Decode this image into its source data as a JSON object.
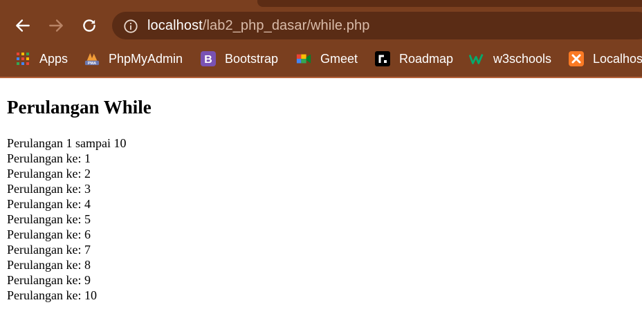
{
  "browser": {
    "url_host": "localhost",
    "url_path": "/lab2_php_dasar/while.php",
    "bookmarks": [
      {
        "label": "Apps",
        "icon": "apps-grid-icon"
      },
      {
        "label": "PhpMyAdmin",
        "icon": "phpmyadmin-icon"
      },
      {
        "label": "Bootstrap",
        "icon": "bootstrap-icon"
      },
      {
        "label": "Gmeet",
        "icon": "gmeet-icon"
      },
      {
        "label": "Roadmap",
        "icon": "roadmap-icon"
      },
      {
        "label": "w3schools",
        "icon": "w3schools-icon"
      },
      {
        "label": "Localhost",
        "icon": "xampp-icon"
      }
    ]
  },
  "page": {
    "heading": "Perulangan While",
    "lines": [
      "Perulangan 1 sampai 10",
      "Perulangan ke: 1",
      "Perulangan ke: 2",
      "Perulangan ke: 3",
      "Perulangan ke: 4",
      "Perulangan ke: 5",
      "Perulangan ke: 6",
      "Perulangan ke: 7",
      "Perulangan ke: 8",
      "Perulangan ke: 9",
      "Perulangan ke: 10"
    ]
  }
}
